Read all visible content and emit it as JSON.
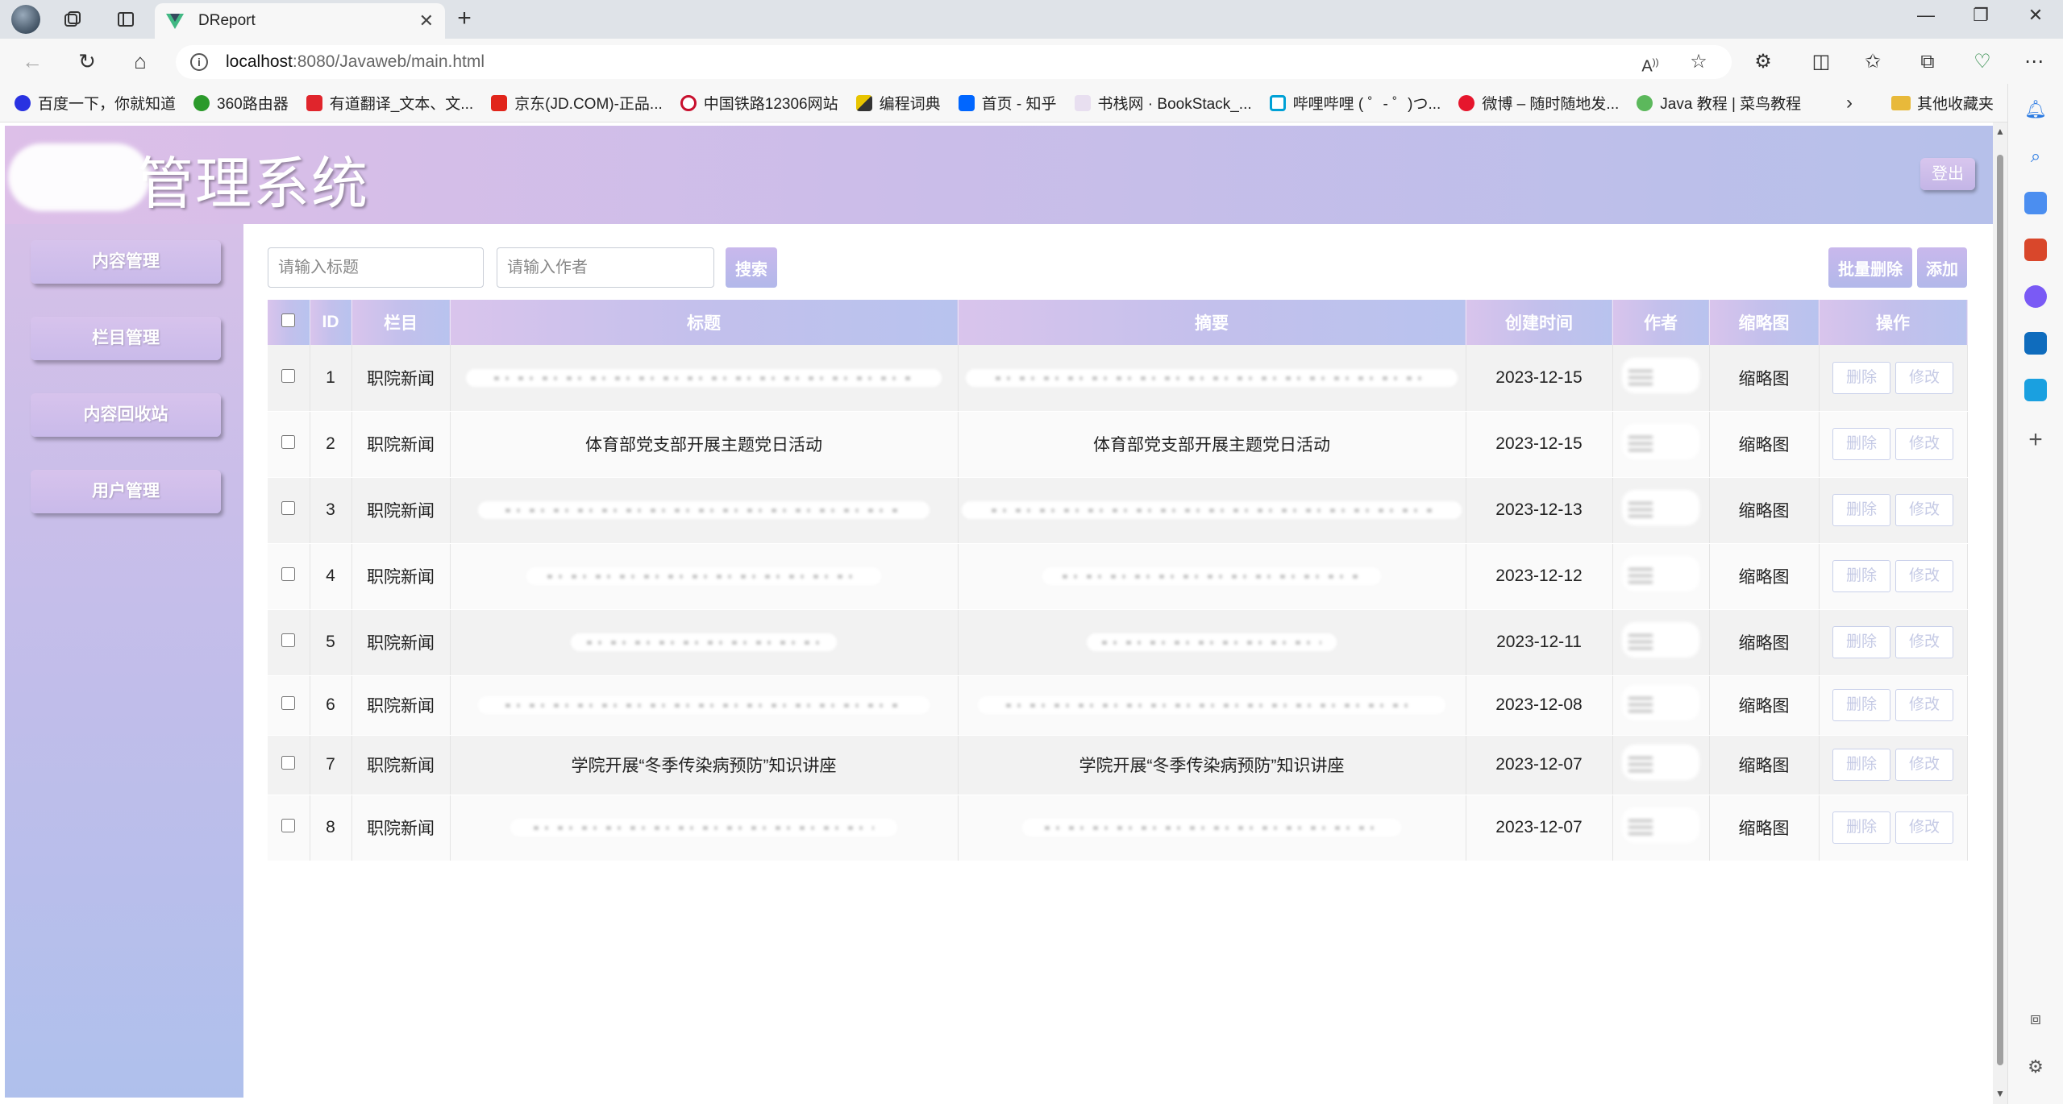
{
  "browser": {
    "tab_title": "DReport",
    "url_host": "localhost",
    "url_path": ":8080/Javaweb/main.html",
    "bookmarks": [
      {
        "label": "百度一下，你就知道",
        "color": "#2932e1"
      },
      {
        "label": "360路由器",
        "color": "#2b9a2b"
      },
      {
        "label": "有道翻译_文本、文...",
        "color": "#e0252c"
      },
      {
        "label": "京东(JD.COM)-正品...",
        "color": "#e1251b"
      },
      {
        "label": "中国铁路12306网站",
        "color": "#c8102e"
      },
      {
        "label": "编程词典",
        "color": "#333333"
      },
      {
        "label": "首页 - 知乎",
        "color": "#0066ff"
      },
      {
        "label": "书栈网 · BookStack_...",
        "color": "#c0a0d8"
      },
      {
        "label": "哔哩哔哩 ( ゜- ゜)つ...",
        "color": "#00a1d6"
      },
      {
        "label": "微博 – 随时随地发...",
        "color": "#e6162d"
      },
      {
        "label": "Java 教程 | 菜鸟教程",
        "color": "#5cb85c"
      }
    ],
    "other_bookmarks": "其他收藏夹"
  },
  "header": {
    "title": "管理系统",
    "logout": "登出"
  },
  "sidebar": {
    "items": [
      {
        "label": "内容管理"
      },
      {
        "label": "栏目管理"
      },
      {
        "label": "内容回收站"
      },
      {
        "label": "用户管理"
      }
    ]
  },
  "toolbar": {
    "title_placeholder": "请输入标题",
    "author_placeholder": "请输入作者",
    "search": "搜索",
    "batch_delete": "批量删除",
    "add": "添加"
  },
  "table": {
    "columns": [
      "ID",
      "栏目",
      "标题",
      "摘要",
      "创建时间",
      "作者",
      "缩略图",
      "操作"
    ],
    "rows": [
      {
        "id": "1",
        "column": "职院新闻",
        "title": "",
        "summary": "",
        "created": "2023-12-15",
        "thumb": "缩略图"
      },
      {
        "id": "2",
        "column": "职院新闻",
        "title": "体育部党支部开展主题党日活动",
        "summary": "体育部党支部开展主题党日活动",
        "created": "2023-12-15",
        "thumb": "缩略图"
      },
      {
        "id": "3",
        "column": "职院新闻",
        "title": "",
        "summary": "",
        "created": "2023-12-13",
        "thumb": "缩略图"
      },
      {
        "id": "4",
        "column": "职院新闻",
        "title": "",
        "summary": "",
        "created": "2023-12-12",
        "thumb": "缩略图"
      },
      {
        "id": "5",
        "column": "职院新闻",
        "title": "",
        "summary": "",
        "created": "2023-12-11",
        "thumb": "缩略图"
      },
      {
        "id": "6",
        "column": "职院新闻",
        "title": "",
        "summary": "",
        "created": "2023-12-08",
        "thumb": "缩略图"
      },
      {
        "id": "7",
        "column": "职院新闻",
        "title": "学院开展“冬季传染病预防”知识讲座",
        "summary": "学院开展“冬季传染病预防”知识讲座",
        "created": "2023-12-07",
        "thumb": "缩略图"
      },
      {
        "id": "8",
        "column": "职院新闻",
        "title": "",
        "summary": "",
        "created": "2023-12-07",
        "thumb": "缩略图"
      }
    ],
    "delete_label": "删除",
    "edit_label": "修改"
  }
}
